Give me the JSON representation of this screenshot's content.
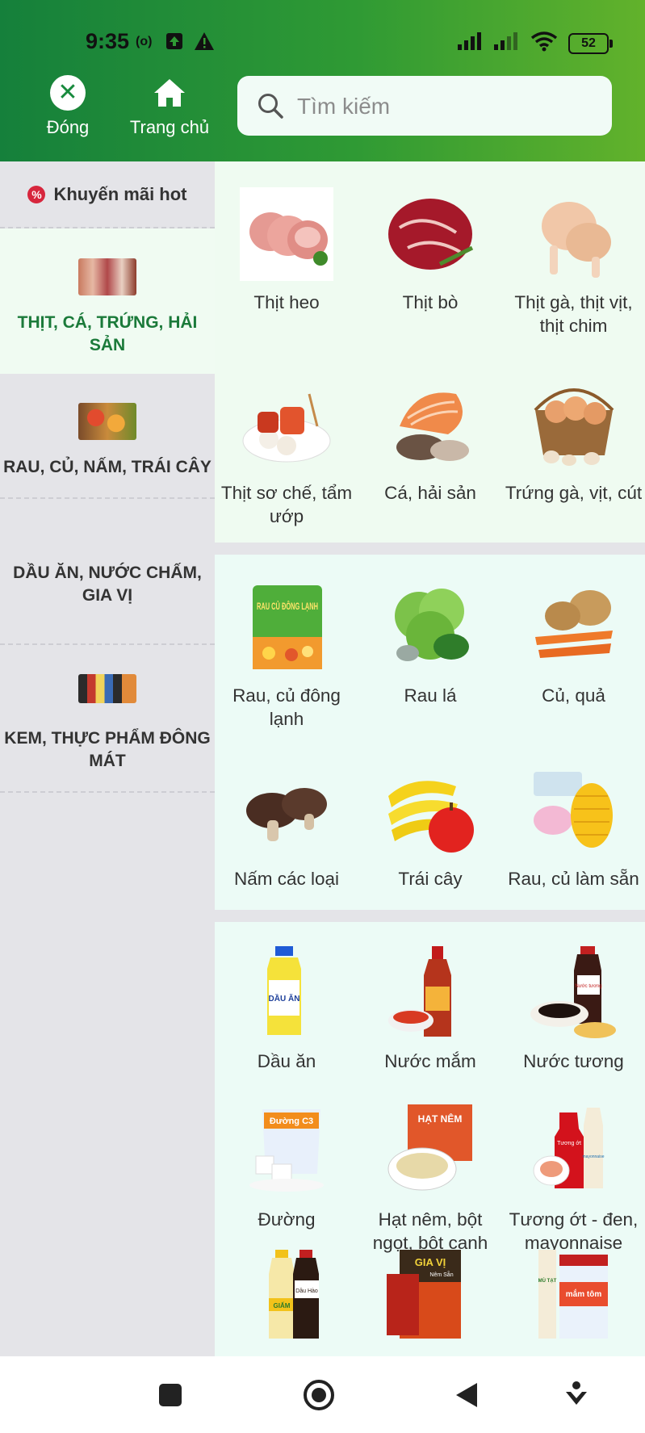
{
  "status_bar": {
    "time": "9:35",
    "radio_icon": "(o)",
    "battery": "52"
  },
  "header": {
    "close_label": "Đóng",
    "home_label": "Trang chủ",
    "search_placeholder": "Tìm kiếm"
  },
  "sidebar": {
    "promo": "Khuyến mãi hot",
    "categories": [
      {
        "label": "THỊT, CÁ, TRỨNG, HẢI SẢN",
        "active": true
      },
      {
        "label": "RAU, CỦ, NẤM, TRÁI CÂY",
        "active": false
      },
      {
        "label": "DẦU ĂN, NƯỚC CHẤM, GIA VỊ",
        "active": false
      },
      {
        "label": "KEM, THỰC PHẨM ĐÔNG MÁT",
        "active": false
      }
    ]
  },
  "sections": [
    {
      "items": [
        "Thịt heo",
        "Thịt bò",
        "Thịt gà, thịt vịt, thịt chim",
        "Thịt sơ chế, tẩm ướp",
        "Cá, hải sản",
        "Trứng gà, vịt, cút"
      ]
    },
    {
      "items": [
        "Rau, củ đông lạnh",
        "Rau lá",
        "Củ, quả",
        "Nấm các loại",
        "Trái cây",
        "Rau, củ làm sẵn"
      ]
    },
    {
      "items": [
        "Dầu ăn",
        "Nước mắm",
        "Nước tương",
        "Đường",
        "Hạt nêm, bột ngọt, bột canh",
        "Tương ớt - đen, mayonnaise"
      ]
    }
  ],
  "product_labels": {
    "rau_cu_pack": "RAU CỦ ĐÔNG LẠNH",
    "dau_an_bottle": "DẦU ĂN",
    "nuoc_tuong": "Nước tương",
    "duong_bag": "Đường C3",
    "hat_nem_box": "HẠT NÊM",
    "tuong_ot_bottle": "Tương ớt",
    "mayonnaise_bottle": "mayonnaise",
    "giam": "GIẤM",
    "dau_hao": "Dầu Hào",
    "gia_vi_box": "GIA VỊ",
    "gia_vi_sub": "Nêm Sẵn",
    "mu_tat": "MÙ TẠT",
    "mam_tom": "mắm tôm"
  },
  "colors": {
    "header_start": "#15803b",
    "header_end": "#62b22b",
    "active_text": "#1b7a3a",
    "section1_bg": "#effbf1",
    "section_bg": "#ecfbf6",
    "sidebar_bg": "#e4e4e8"
  },
  "navbar": {
    "icons": [
      "recent-apps-icon",
      "home-circle-icon",
      "back-icon",
      "assistant-icon"
    ]
  }
}
